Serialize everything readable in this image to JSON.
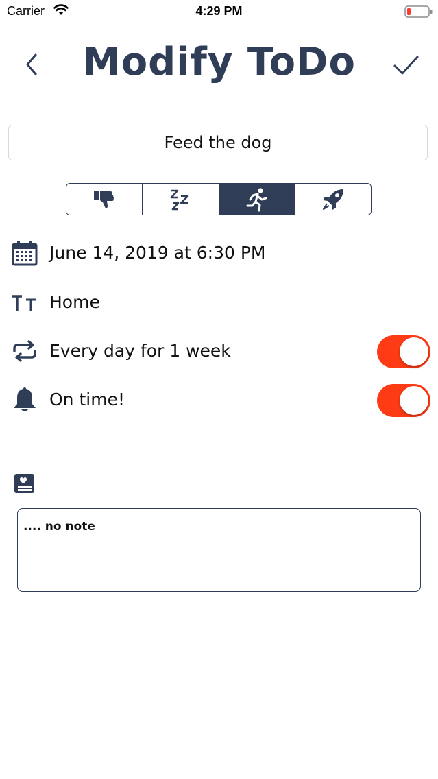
{
  "status_bar": {
    "carrier": "Carrier",
    "time": "4:29 PM"
  },
  "header": {
    "title": "Modify ToDo",
    "back_icon": "chevron-left-icon",
    "done_icon": "checkmark-icon"
  },
  "todo": {
    "title": "Feed the dog"
  },
  "priority": {
    "segments": [
      {
        "icon": "thumbs-down-icon",
        "selected": false
      },
      {
        "icon": "sleep-zzz-icon",
        "selected": false
      },
      {
        "icon": "running-person-icon",
        "selected": true
      },
      {
        "icon": "rocket-icon",
        "selected": false
      }
    ]
  },
  "details": {
    "date": "June 14, 2019 at 6:30 PM",
    "category": "Home",
    "repeat": "Every day for 1 week",
    "repeat_enabled": true,
    "reminder": "On time!",
    "reminder_enabled": true
  },
  "note": {
    "text": ".... no note"
  },
  "colors": {
    "primary": "#2f3d57",
    "toggle_on": "#ff3b15",
    "battery_low": "#ff3b30"
  }
}
